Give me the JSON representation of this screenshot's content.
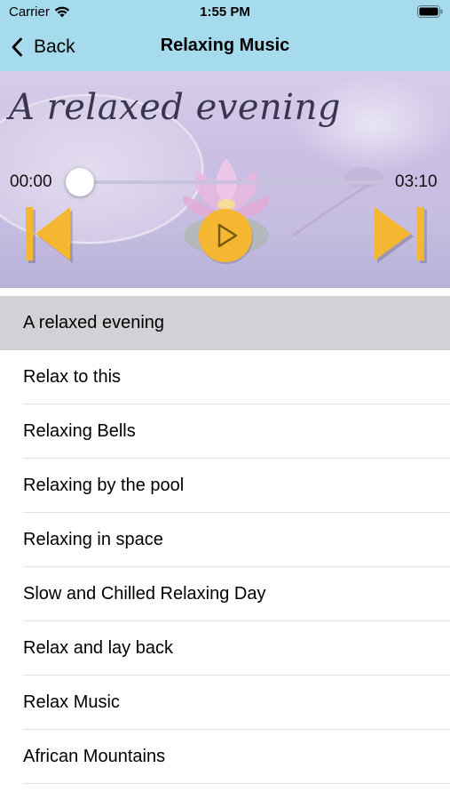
{
  "status_bar": {
    "carrier": "Carrier",
    "time": "1:55 PM"
  },
  "nav": {
    "back_label": "Back",
    "title": "Relaxing Music"
  },
  "player": {
    "now_playing_title": "A relaxed evening",
    "elapsed": "00:00",
    "duration": "03:10",
    "progress": 0,
    "accent_color": "#f5b732"
  },
  "playlist": {
    "selected_index": 0,
    "items": [
      {
        "label": "A relaxed evening"
      },
      {
        "label": "Relax to this"
      },
      {
        "label": "Relaxing Bells"
      },
      {
        "label": "Relaxing by the pool"
      },
      {
        "label": "Relaxing in space"
      },
      {
        "label": "Slow and Chilled Relaxing Day"
      },
      {
        "label": "Relax and lay back"
      },
      {
        "label": "Relax Music"
      },
      {
        "label": "African Mountains"
      }
    ]
  },
  "icons": {
    "back": "chevron-left-icon",
    "wifi": "wifi-icon",
    "battery": "battery-icon",
    "previous": "skip-previous-icon",
    "play": "play-icon",
    "next": "skip-next-icon"
  },
  "colors": {
    "header_bg": "#a6dbee",
    "selected_row_bg": "#d1d1d6",
    "control_accent": "#f5b732"
  }
}
